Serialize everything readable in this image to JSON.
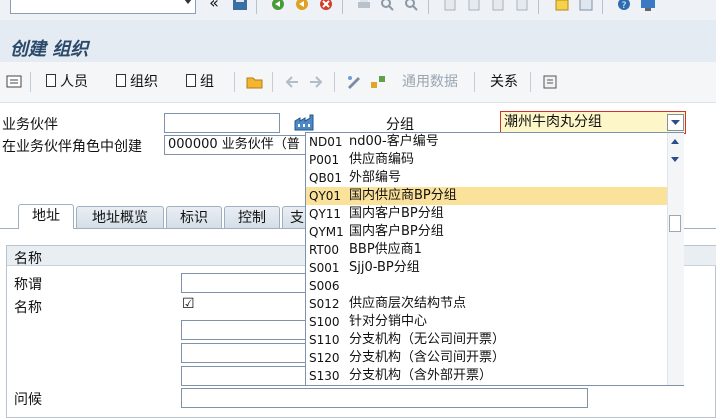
{
  "system_toolbar": {
    "command_field_value": "",
    "collapse_glyph": "«",
    "icons": [
      "save-icon",
      "back-icon",
      "exit-icon",
      "cancel-icon",
      "print-icon",
      "find-icon",
      "find-next-icon",
      "first-page-icon",
      "prev-page-icon",
      "next-page-icon",
      "last-page-icon",
      "new-session-icon",
      "shortcut-icon",
      "help-icon",
      "layout-icon"
    ]
  },
  "title": "创建 组织",
  "app_toolbar": {
    "person_label": "人员",
    "organization_label": "组织",
    "group_label": "组",
    "general_data_label": "通用数据",
    "relationships_label": "关系"
  },
  "form": {
    "partner_label": "业务伙伴",
    "partner_value": "",
    "create_in_role_label": "在业务伙伴角色中创建",
    "create_in_role_value": "000000 业务伙伴（普",
    "grouping_label": "分组",
    "grouping_value": "潮州牛肉丸分组"
  },
  "tabs": [
    "地址",
    "地址概览",
    "标识",
    "控制",
    "支"
  ],
  "group_box": {
    "header": "名称",
    "title_label": "称谓",
    "name_label": "名称",
    "greeting_label": "问候",
    "name_check_glyph": "☑"
  },
  "dropdown": {
    "selected_code": "QY01",
    "options": [
      {
        "code": "ND01",
        "text": "nd00-客户编号"
      },
      {
        "code": "P001",
        "text": "供应商编码"
      },
      {
        "code": "QB01",
        "text": "外部编号"
      },
      {
        "code": "QY01",
        "text": "国内供应商BP分组"
      },
      {
        "code": "QY11",
        "text": "国内客户BP分组"
      },
      {
        "code": "QYM1",
        "text": "国内客户BP分组"
      },
      {
        "code": "RT00",
        "text": "BBP供应商1"
      },
      {
        "code": "S001",
        "text": "Sjj0-BP分组"
      },
      {
        "code": "S006",
        "text": ""
      },
      {
        "code": "S012",
        "text": "供应商层次结构节点"
      },
      {
        "code": "S100",
        "text": "针对分销中心"
      },
      {
        "code": "S110",
        "text": "分支机构（无公司间开票）"
      },
      {
        "code": "S120",
        "text": "分支机构（含公司间开票）"
      },
      {
        "code": "S130",
        "text": "分支机构（含外部开票）"
      }
    ]
  },
  "colors": {
    "accent": "#2b4a6b",
    "selected_row": "#fbe29a",
    "focus_border": "#d0342c"
  }
}
